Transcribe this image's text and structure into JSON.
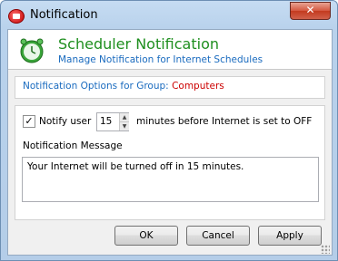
{
  "window": {
    "title": "Notification",
    "close": "✕"
  },
  "header": {
    "title": "Scheduler Notification",
    "subtitle": "Manage Notification for Internet Schedules"
  },
  "group": {
    "label": "Notification Options for Group:",
    "name": "Computers"
  },
  "options": {
    "notify_checked": true,
    "notify_label": "Notify user",
    "minutes_value": "15",
    "minutes_label": "minutes before Internet is set to OFF",
    "message_label": "Notification Message",
    "message_value": "Your Internet will be turned off in 15 minutes."
  },
  "buttons": {
    "ok": "OK",
    "cancel": "Cancel",
    "apply": "Apply"
  },
  "check_glyph": "✓"
}
